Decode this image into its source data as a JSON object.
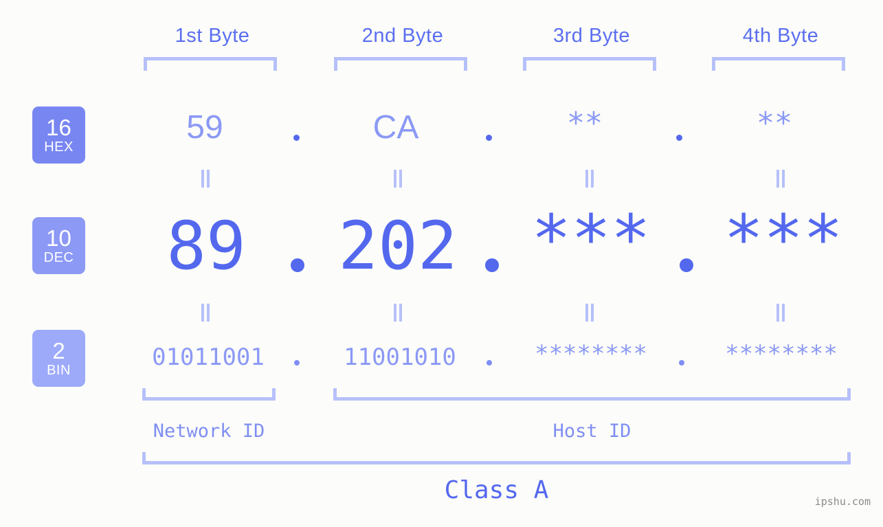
{
  "background_color": "#fcfdfa",
  "accent_colors": {
    "strong_blue": "#5468ee",
    "mid_blue": "#8b99f5",
    "light_blue": "#b6c0fa",
    "badge_hex": "#7886f2",
    "badge_dec": "#8c99f5",
    "badge_bin": "#9daafa",
    "watermark_gray": "#8a8a8a"
  },
  "header": {
    "byte_labels": [
      {
        "label": "1st Byte"
      },
      {
        "label": "2nd Byte"
      },
      {
        "label": "3rd Byte"
      },
      {
        "label": "4th Byte"
      }
    ]
  },
  "rows": [
    {
      "id": "hex",
      "badge_number": "16",
      "badge_name": "HEX",
      "values": [
        "59",
        "CA",
        "**",
        "**"
      ],
      "separators": [
        ".",
        ".",
        "."
      ]
    },
    {
      "id": "dec",
      "badge_number": "10",
      "badge_name": "DEC",
      "values": [
        "89",
        "202",
        "***",
        "***"
      ],
      "separators": [
        ".",
        ".",
        "."
      ]
    },
    {
      "id": "bin",
      "badge_number": "2",
      "badge_name": "BIN",
      "values": [
        "01011001",
        "11001010",
        "********",
        "********"
      ],
      "separators": [
        ".",
        ".",
        "."
      ]
    }
  ],
  "equality_marks": {
    "symbol": "=",
    "count_per_gap": 4
  },
  "footer": {
    "network_id_label": "Network ID",
    "host_id_label": "Host ID",
    "class_label": "Class A"
  },
  "watermark": "ipshu.com"
}
